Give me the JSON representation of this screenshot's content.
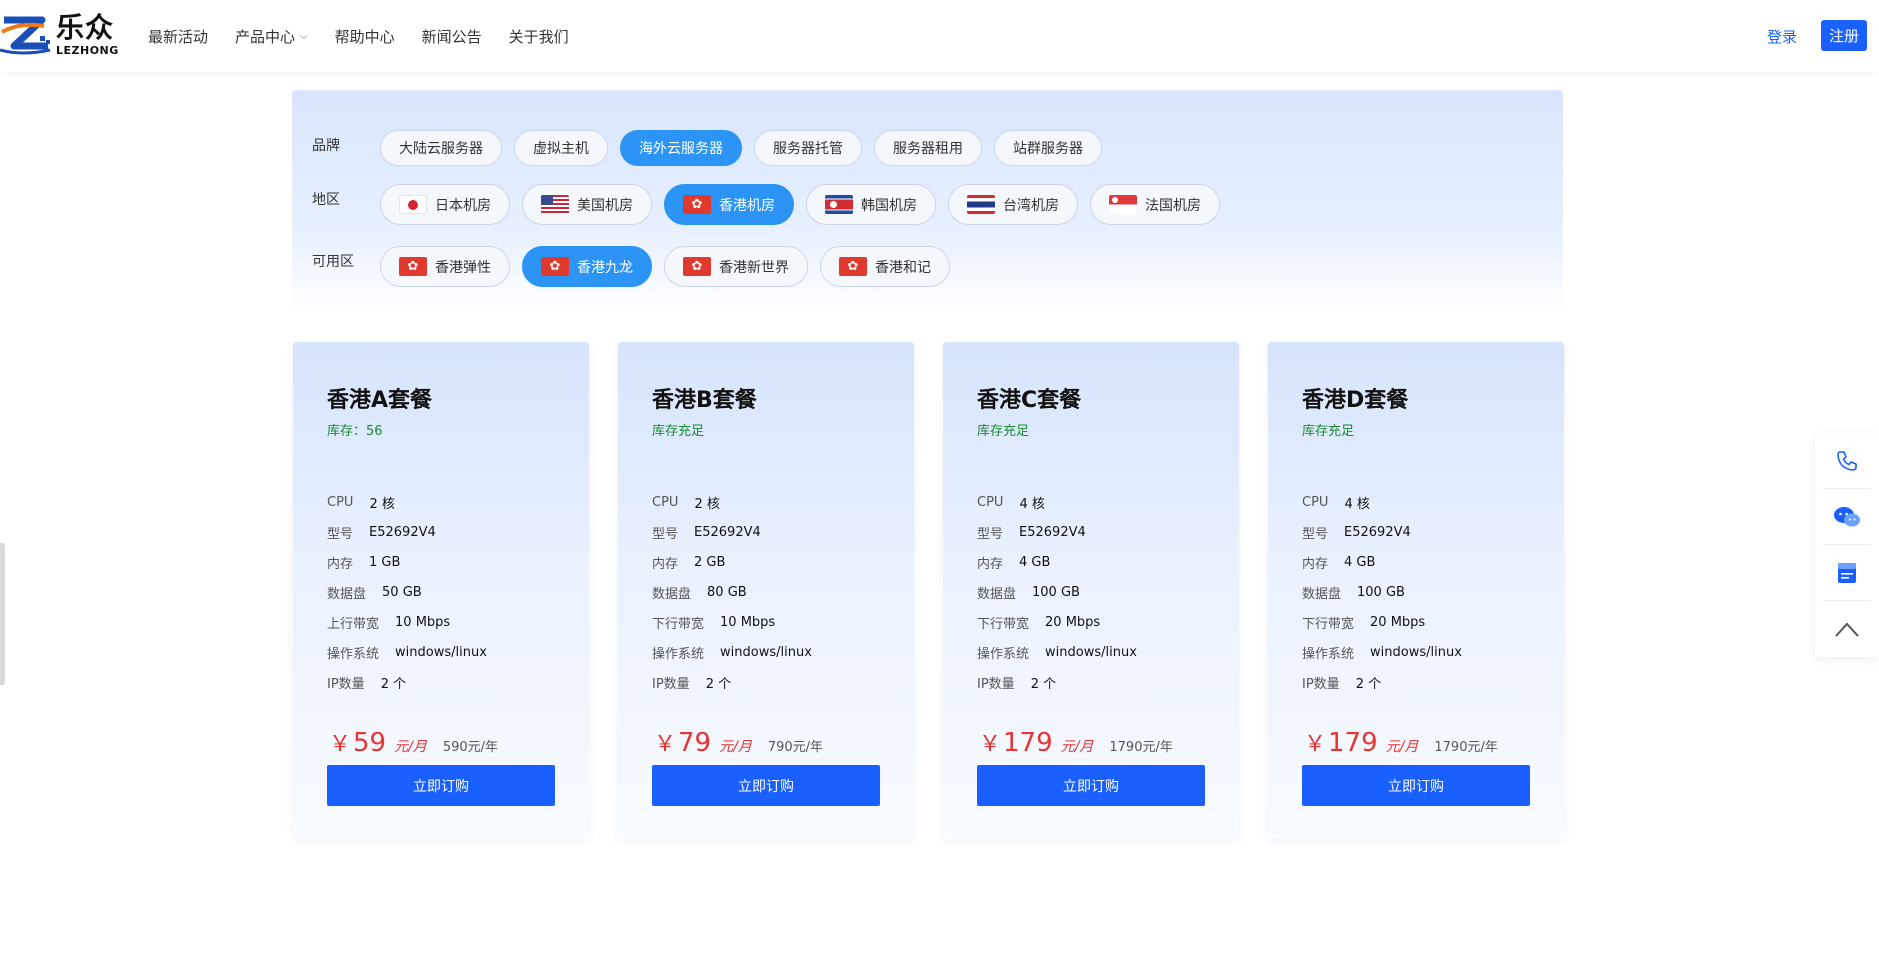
{
  "brand": {
    "name_cn": "乐众",
    "name_en": "LEZHONG"
  },
  "nav": [
    {
      "label": "最新活动",
      "has_dropdown": false
    },
    {
      "label": "产品中心",
      "has_dropdown": true
    },
    {
      "label": "帮助中心",
      "has_dropdown": false
    },
    {
      "label": "新闻公告",
      "has_dropdown": false
    },
    {
      "label": "关于我们",
      "has_dropdown": false
    }
  ],
  "auth": {
    "login": "登录",
    "register": "注册"
  },
  "filters": {
    "brand": {
      "label": "品牌",
      "options": [
        "大陆云服务器",
        "虚拟主机",
        "海外云服务器",
        "服务器托管",
        "服务器租用",
        "站群服务器"
      ],
      "selected": "海外云服务器"
    },
    "region": {
      "label": "地区",
      "options": [
        {
          "label": "日本机房",
          "flag": "flag-jp"
        },
        {
          "label": "美国机房",
          "flag": "flag-us"
        },
        {
          "label": "香港机房",
          "flag": "flag-hk"
        },
        {
          "label": "韩国机房",
          "flag": "flag-kp"
        },
        {
          "label": "台湾机房",
          "flag": "flag-th"
        },
        {
          "label": "法国机房",
          "flag": "flag-sg"
        }
      ],
      "selected": "香港机房"
    },
    "zone": {
      "label": "可用区",
      "options": [
        {
          "label": "香港弹性",
          "flag": "flag-hk"
        },
        {
          "label": "香港九龙",
          "flag": "flag-hk"
        },
        {
          "label": "香港新世界",
          "flag": "flag-hk"
        },
        {
          "label": "香港和记",
          "flag": "flag-hk"
        }
      ],
      "selected": "香港九龙"
    }
  },
  "plans": [
    {
      "title": "香港A套餐",
      "stock": "库存：56",
      "specs": [
        {
          "label": "CPU",
          "value": "2 核"
        },
        {
          "label": "型号",
          "value": "E52692V4"
        },
        {
          "label": "内存",
          "value": "1 GB"
        },
        {
          "label": "数据盘",
          "value": "50 GB"
        },
        {
          "label": "上行带宽",
          "value": "10 Mbps"
        },
        {
          "label": "操作系统",
          "value": "windows/linux"
        },
        {
          "label": "IP数量",
          "value": "2 个"
        }
      ],
      "price_symbol": "￥",
      "price": "59",
      "price_unit": "元/月",
      "price_year": "590元/年",
      "button": "立即订购"
    },
    {
      "title": "香港B套餐",
      "stock": "库存充足",
      "specs": [
        {
          "label": "CPU",
          "value": "2 核"
        },
        {
          "label": "型号",
          "value": "E52692V4"
        },
        {
          "label": "内存",
          "value": "2 GB"
        },
        {
          "label": "数据盘",
          "value": "80 GB"
        },
        {
          "label": "下行带宽",
          "value": "10 Mbps"
        },
        {
          "label": "操作系统",
          "value": "windows/linux"
        },
        {
          "label": "IP数量",
          "value": "2 个"
        }
      ],
      "price_symbol": "￥",
      "price": "79",
      "price_unit": "元/月",
      "price_year": "790元/年",
      "button": "立即订购"
    },
    {
      "title": "香港C套餐",
      "stock": "库存充足",
      "specs": [
        {
          "label": "CPU",
          "value": "4 核"
        },
        {
          "label": "型号",
          "value": "E52692V4"
        },
        {
          "label": "内存",
          "value": "4 GB"
        },
        {
          "label": "数据盘",
          "value": "100 GB"
        },
        {
          "label": "下行带宽",
          "value": "20 Mbps"
        },
        {
          "label": "操作系统",
          "value": "windows/linux"
        },
        {
          "label": "IP数量",
          "value": "2 个"
        }
      ],
      "price_symbol": "￥",
      "price": "179",
      "price_unit": "元/月",
      "price_year": "1790元/年",
      "button": "立即订购"
    },
    {
      "title": "香港D套餐",
      "stock": "库存充足",
      "specs": [
        {
          "label": "CPU",
          "value": "4 核"
        },
        {
          "label": "型号",
          "value": "E52692V4"
        },
        {
          "label": "内存",
          "value": "4 GB"
        },
        {
          "label": "数据盘",
          "value": "100 GB"
        },
        {
          "label": "下行带宽",
          "value": "20 Mbps"
        },
        {
          "label": "操作系统",
          "value": "windows/linux"
        },
        {
          "label": "IP数量",
          "value": "2 个"
        }
      ],
      "price_symbol": "￥",
      "price": "179",
      "price_unit": "元/月",
      "price_year": "1790元/年",
      "button": "立即订购"
    }
  ],
  "side_tools": [
    "phone-icon",
    "wechat-icon",
    "document-icon",
    "back-to-top-icon"
  ],
  "colors": {
    "primary": "#1a5fff",
    "active_pill": "#2b94f5",
    "price": "#e83333",
    "stock": "#1a8a33"
  }
}
